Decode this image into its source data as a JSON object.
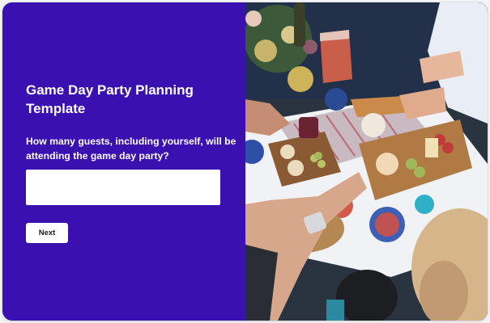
{
  "form": {
    "title": "Game Day Party Planning Template",
    "question": "How many guests, including yourself, will be attending the game day party?",
    "answer_value": "",
    "next_label": "Next"
  },
  "colors": {
    "panel": "#3a10b0",
    "input_bg": "#ffffff",
    "button_bg": "#ffffff"
  },
  "photo": {
    "icon": "party-table-photo"
  }
}
